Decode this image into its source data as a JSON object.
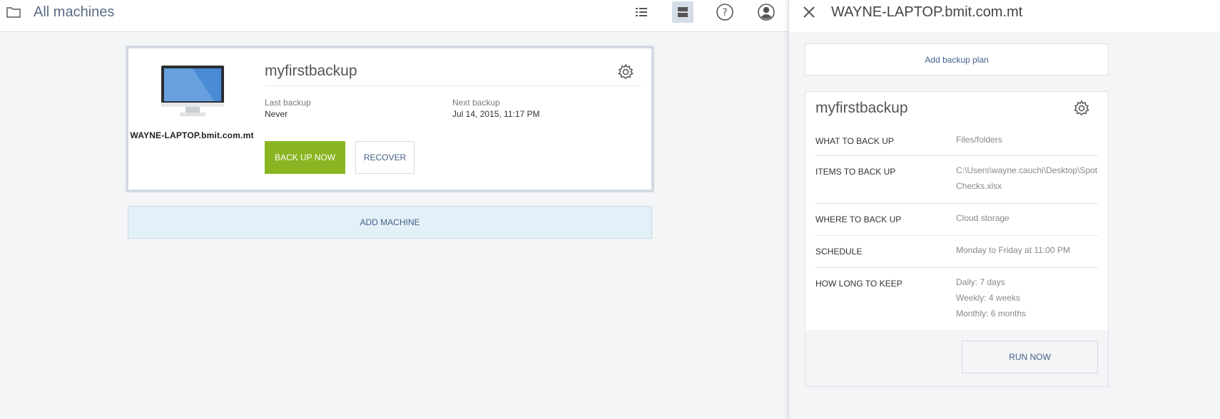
{
  "header": {
    "title": "All machines",
    "icons": [
      "folder-icon",
      "list-view-icon",
      "tile-view-icon",
      "help-icon",
      "user-icon"
    ]
  },
  "machine_card": {
    "machine_name": "WAYNE-LAPTOP.bmit.com.mt",
    "plan_name": "myfirstbackup",
    "last_backup_label": "Last backup",
    "last_backup_value": "Never",
    "next_backup_label": "Next backup",
    "next_backup_value": "Jul 14, 2015, 11:17 PM",
    "backup_now_label": "BACK UP NOW",
    "recover_label": "RECOVER"
  },
  "add_machine_label": "ADD MACHINE",
  "panel": {
    "title": "WAYNE-LAPTOP.bmit.com.mt",
    "add_plan_label": "Add backup plan",
    "plan": {
      "name": "myfirstbackup",
      "rows": [
        {
          "key": "WHAT TO BACK UP",
          "value": [
            "Files/folders"
          ]
        },
        {
          "key": "ITEMS TO BACK UP",
          "value": [
            "C:\\Users\\wayne.cauchi\\Desktop\\Spot Checks.xlsx"
          ]
        },
        {
          "key": "WHERE TO BACK UP",
          "value": [
            "Cloud storage"
          ]
        },
        {
          "key": "SCHEDULE",
          "value": [
            "Monday to Friday at 11:00 PM"
          ]
        },
        {
          "key": "HOW LONG TO KEEP",
          "value": [
            "Daily: 7 days",
            "Weekly: 4 weeks",
            "Monthly: 6 months"
          ]
        }
      ]
    },
    "run_now_label": "RUN NOW"
  },
  "colors": {
    "accent_green": "#8ab522",
    "link_blue": "#47608a",
    "add_machine_bg": "#e4f0f8",
    "active_toggle_bg": "#d5dde8"
  }
}
